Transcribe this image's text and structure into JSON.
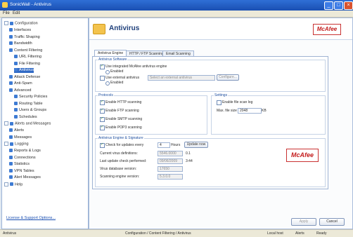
{
  "window": {
    "title": "SonicWall - Antivirus",
    "min_glyph": "_",
    "max_glyph": "□",
    "close_glyph": "×"
  },
  "menu": [
    "File",
    "Edit"
  ],
  "sidebar": {
    "items": [
      {
        "label": "Configuration",
        "level": 0,
        "icon": "folder-icon"
      },
      {
        "label": "Interfaces",
        "level": 1,
        "icon": "network-icon"
      },
      {
        "label": "Traffic Shaping",
        "level": 1,
        "icon": "traffic-icon"
      },
      {
        "label": "Bandwidth",
        "level": 1,
        "icon": "bandwidth-icon"
      },
      {
        "label": "Content Filtering",
        "level": 1,
        "icon": "filter-icon"
      },
      {
        "label": "URL Filtering",
        "level": 2,
        "icon": "url-icon"
      },
      {
        "label": "File Filtering",
        "level": 2,
        "icon": "file-icon"
      },
      {
        "label": "Antivirus",
        "level": 2,
        "icon": "shield-icon",
        "selected": true
      },
      {
        "label": "Attack Defense",
        "level": 1,
        "icon": "attack-icon"
      },
      {
        "label": "Anti-Spam",
        "level": 1,
        "icon": "spam-icon"
      },
      {
        "label": "Advanced",
        "level": 1,
        "icon": "advanced-icon"
      },
      {
        "label": "Security Policies",
        "level": 2,
        "icon": "policy-icon"
      },
      {
        "label": "Routing Table",
        "level": 2,
        "icon": "routing-icon"
      },
      {
        "label": "Users & Groups",
        "level": 2,
        "icon": "users-icon"
      },
      {
        "label": "Schedules",
        "level": 2,
        "icon": "schedule-icon"
      },
      {
        "label": "Alerts and Messages",
        "level": 0,
        "icon": "alert-icon"
      },
      {
        "label": "Alerts",
        "level": 1,
        "icon": "alert-icon"
      },
      {
        "label": "Messages",
        "level": 1,
        "icon": "message-icon"
      },
      {
        "label": "Logging",
        "level": 0,
        "icon": "log-icon"
      },
      {
        "label": "Reports & Logs",
        "level": 1,
        "icon": "report-icon"
      },
      {
        "label": "Connections",
        "level": 1,
        "icon": "connection-icon"
      },
      {
        "label": "Statistics",
        "level": 1,
        "icon": "stats-icon"
      },
      {
        "label": "VPN Tables",
        "level": 1,
        "icon": "vpn-icon"
      },
      {
        "label": "Alert Messages",
        "level": 1,
        "icon": "alert-icon"
      },
      {
        "label": "Help",
        "level": 0,
        "icon": "help-icon"
      }
    ],
    "link": "License & Support Options..."
  },
  "header": {
    "title": "Antivirus",
    "brand": "McAfee"
  },
  "tabs": [
    {
      "label": "Antivirus Engine",
      "active": true
    },
    {
      "label": "HTTP / FTP Scanning",
      "active": false
    },
    {
      "label": "Email Scanning",
      "active": false
    }
  ],
  "engine_group": {
    "label": "Antivirus Software",
    "opt1": "Use integrated McAfee antivirus engine",
    "opt1_sub": "Enabled",
    "opt2": "Use external antivirus",
    "opt2_field": "Select an external antivirus",
    "opt2_btn": "Configure...",
    "opt2_sub": "Enabled"
  },
  "protocols_group": {
    "label": "Protocols",
    "items": [
      "Enable HTTP scanning",
      "Enable FTP scanning",
      "Enable SMTP scanning",
      "Enable POP3 scanning"
    ]
  },
  "settings_group": {
    "label": "Settings",
    "log_label": "Enable file scan log",
    "max_label": "Max. file size",
    "max_value": "2048",
    "max_unit": "KB"
  },
  "update_group": {
    "label": "Antivirus Engine & Signature",
    "check_label": "Check for updates every",
    "check_value": "4",
    "check_unit": "Hours",
    "update_btn": "Update now",
    "rows": [
      {
        "label": "Current virus definitions:",
        "value": "5546.0000",
        "unit": "0.1"
      },
      {
        "label": "Last update check performed:",
        "value": "09/06/2009",
        "unit": "3:44"
      },
      {
        "label": "Virus database version:",
        "value": "17650"
      },
      {
        "label": "Scanning engine version:",
        "value": "5.3.0.0"
      }
    ],
    "brand": "McAfee"
  },
  "footer_buttons": {
    "apply": "Apply",
    "cancel": "Cancel"
  },
  "status": {
    "left": "Antivirus",
    "path": "Configuration / Content Filtering / Antivirus",
    "right1": "Local host",
    "right2": "Alerts",
    "right3": "Ready"
  }
}
